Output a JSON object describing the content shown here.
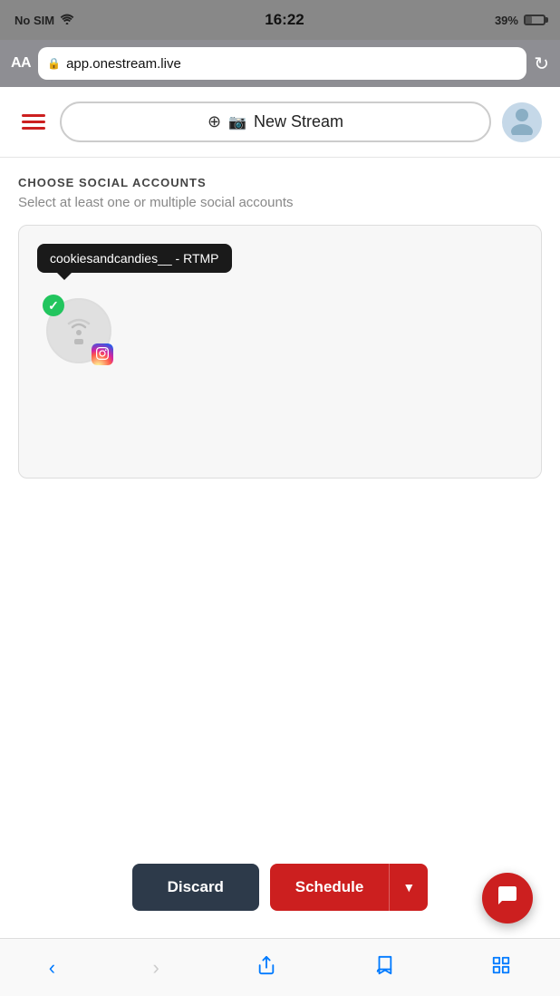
{
  "statusBar": {
    "carrier": "No SIM",
    "time": "16:22",
    "battery": "39%"
  },
  "browserBar": {
    "aa": "AA",
    "url": "app.onestream.live"
  },
  "topNav": {
    "newStreamLabel": "New Stream"
  },
  "page": {
    "sectionTitle": "CHOOSE SOCIAL ACCOUNTS",
    "sectionSubtitle": "Select at least one or multiple social accounts"
  },
  "account": {
    "tooltip": "cookiesandcandies__ - RTMP",
    "platform": "instagram"
  },
  "buttons": {
    "discard": "Discard",
    "schedule": "Schedule"
  }
}
